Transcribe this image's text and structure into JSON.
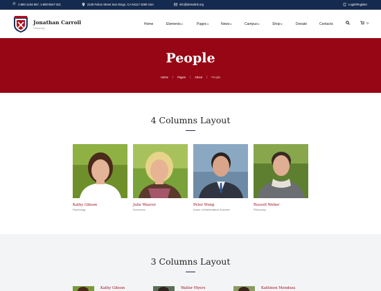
{
  "topbar": {
    "phone": "1-800-1234-567, 1-800-6547-321",
    "address": "2130 Fulton Street San Diego, CA 94117-1080 USA",
    "email": "info@demolink.org",
    "login": "Login/Register"
  },
  "header": {
    "brand_name": "Jonathan Carroll",
    "brand_sub": "University",
    "nav": [
      {
        "label": "Home",
        "dropdown": false
      },
      {
        "label": "Elements",
        "dropdown": true
      },
      {
        "label": "Pages",
        "dropdown": true
      },
      {
        "label": "News",
        "dropdown": true
      },
      {
        "label": "Campus",
        "dropdown": true
      },
      {
        "label": "Shop",
        "dropdown": true
      },
      {
        "label": "Donate",
        "dropdown": false
      },
      {
        "label": "Contacts",
        "dropdown": false
      }
    ],
    "cart_count": "0"
  },
  "hero": {
    "title": "People",
    "breadcrumbs": [
      "Home",
      "Pages",
      "About",
      "People"
    ]
  },
  "section1": {
    "title": "4 Columns Layout",
    "people": [
      {
        "name": "Kathy Gibson",
        "role": "Psychology"
      },
      {
        "name": "Julie Weaver",
        "role": "Economics"
      },
      {
        "name": "Peter Wong",
        "role": "Doctor of Mathematical Sciences"
      },
      {
        "name": "Russell Weber",
        "role": "Philosophy"
      }
    ]
  },
  "section2": {
    "title": "3 Columns Layout",
    "people": [
      {
        "name": "Kathy Gibson"
      },
      {
        "name": "Walter Myers"
      },
      {
        "name": "Kathleen Mendoza"
      }
    ]
  },
  "colors": {
    "topbar": "#152a4f",
    "hero": "#970615",
    "accent_name": "#9a1020",
    "underline": "#1c2e57"
  }
}
